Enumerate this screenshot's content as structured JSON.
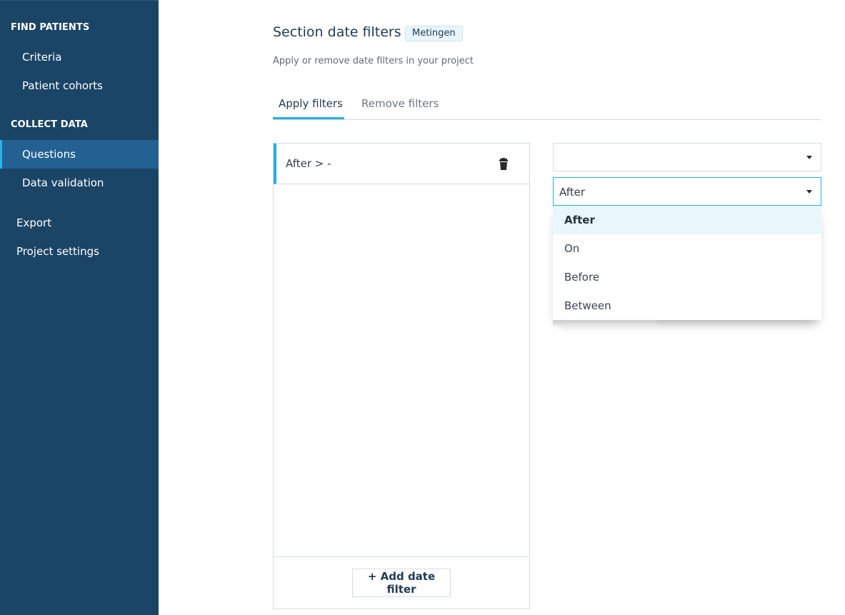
{
  "sidebar": {
    "find_patients_heading": "FIND PATIENTS",
    "criteria": "Criteria",
    "patient_cohorts": "Patient cohorts",
    "collect_data_heading": "COLLECT DATA",
    "questions": "Questions",
    "data_validation": "Data validation",
    "export": "Export",
    "project_settings": "Project settings"
  },
  "header": {
    "title": "Section date filters",
    "badge": "Metingen",
    "subtitle": "Apply or remove date filters in your project"
  },
  "tabs": {
    "apply": "Apply filters",
    "remove": "Remove filters"
  },
  "filter_list": {
    "item_label": "After > -",
    "add_button": "+ Add date filter"
  },
  "selects": {
    "field_value": "",
    "operator_value": "After"
  },
  "operator_menu": {
    "options": [
      "After",
      "On",
      "Before",
      "Between"
    ],
    "selected": "After"
  },
  "colors": {
    "sidebar_bg": "#1b4566",
    "sidebar_active": "#226191",
    "accent": "#21b0e6"
  }
}
